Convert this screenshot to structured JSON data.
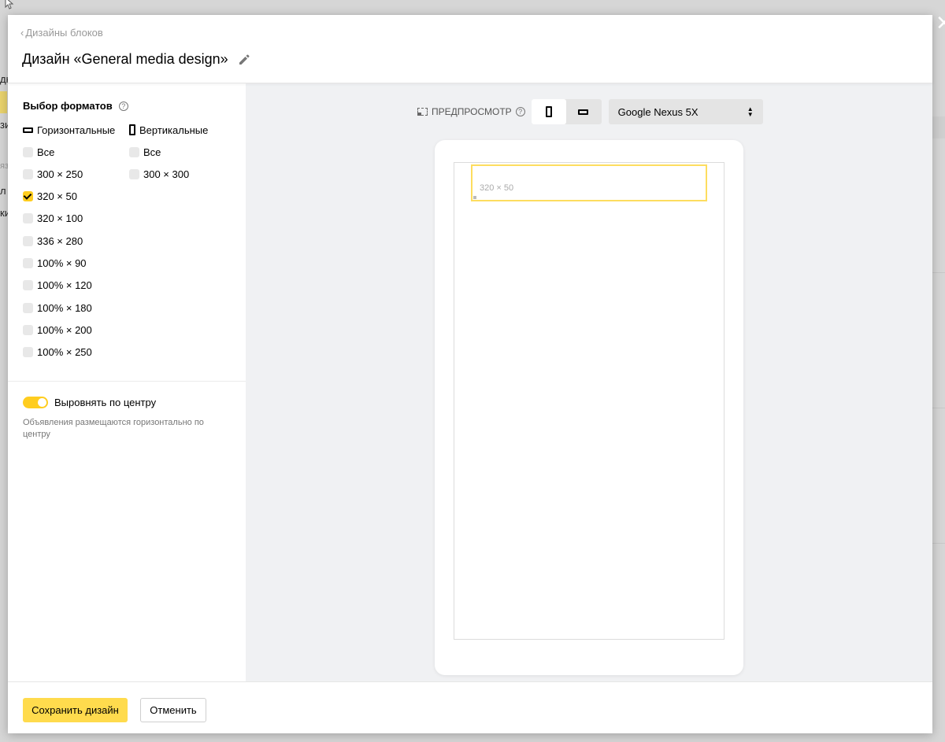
{
  "modal": {
    "back_link": "Дизайны блоков",
    "title": "Дизайн «General media design»"
  },
  "formats": {
    "title": "Выбор форматов",
    "horizontal": {
      "header": "Горизонтальные",
      "options": [
        {
          "label": "Все",
          "checked": false
        },
        {
          "label": "300 × 250",
          "checked": false
        },
        {
          "label": "320 × 50",
          "checked": true
        },
        {
          "label": "320 × 100",
          "checked": false
        },
        {
          "label": "336 × 280",
          "checked": false
        },
        {
          "label": "100% × 90",
          "checked": false
        },
        {
          "label": "100% × 120",
          "checked": false
        },
        {
          "label": "100% × 180",
          "checked": false
        },
        {
          "label": "100% × 200",
          "checked": false
        },
        {
          "label": "100% × 250",
          "checked": false
        }
      ]
    },
    "vertical": {
      "header": "Вертикальные",
      "options": [
        {
          "label": "Все",
          "checked": false
        },
        {
          "label": "300 × 300",
          "checked": false
        }
      ]
    }
  },
  "align": {
    "label": "Выровнять по центру",
    "enabled": true,
    "description": "Объявления размещаются горизонтально по центру"
  },
  "preview": {
    "label": "ПРЕДПРОСМОТР",
    "orientation": "portrait",
    "device": "Google Nexus 5X",
    "ad_label": "320 × 50"
  },
  "footer": {
    "save": "Сохранить дизайн",
    "cancel": "Отменить"
  },
  "background": {
    "left_fragments": [
      "дк",
      "зи",
      "яз",
      "л",
      "ки"
    ],
    "close_glyph": "✕"
  },
  "colors": {
    "accent": "#ffdb4d",
    "checkbox_checked": "#ffcd1f",
    "ad_border": "#fddd5f",
    "preview_bg": "#f0f1f3"
  }
}
